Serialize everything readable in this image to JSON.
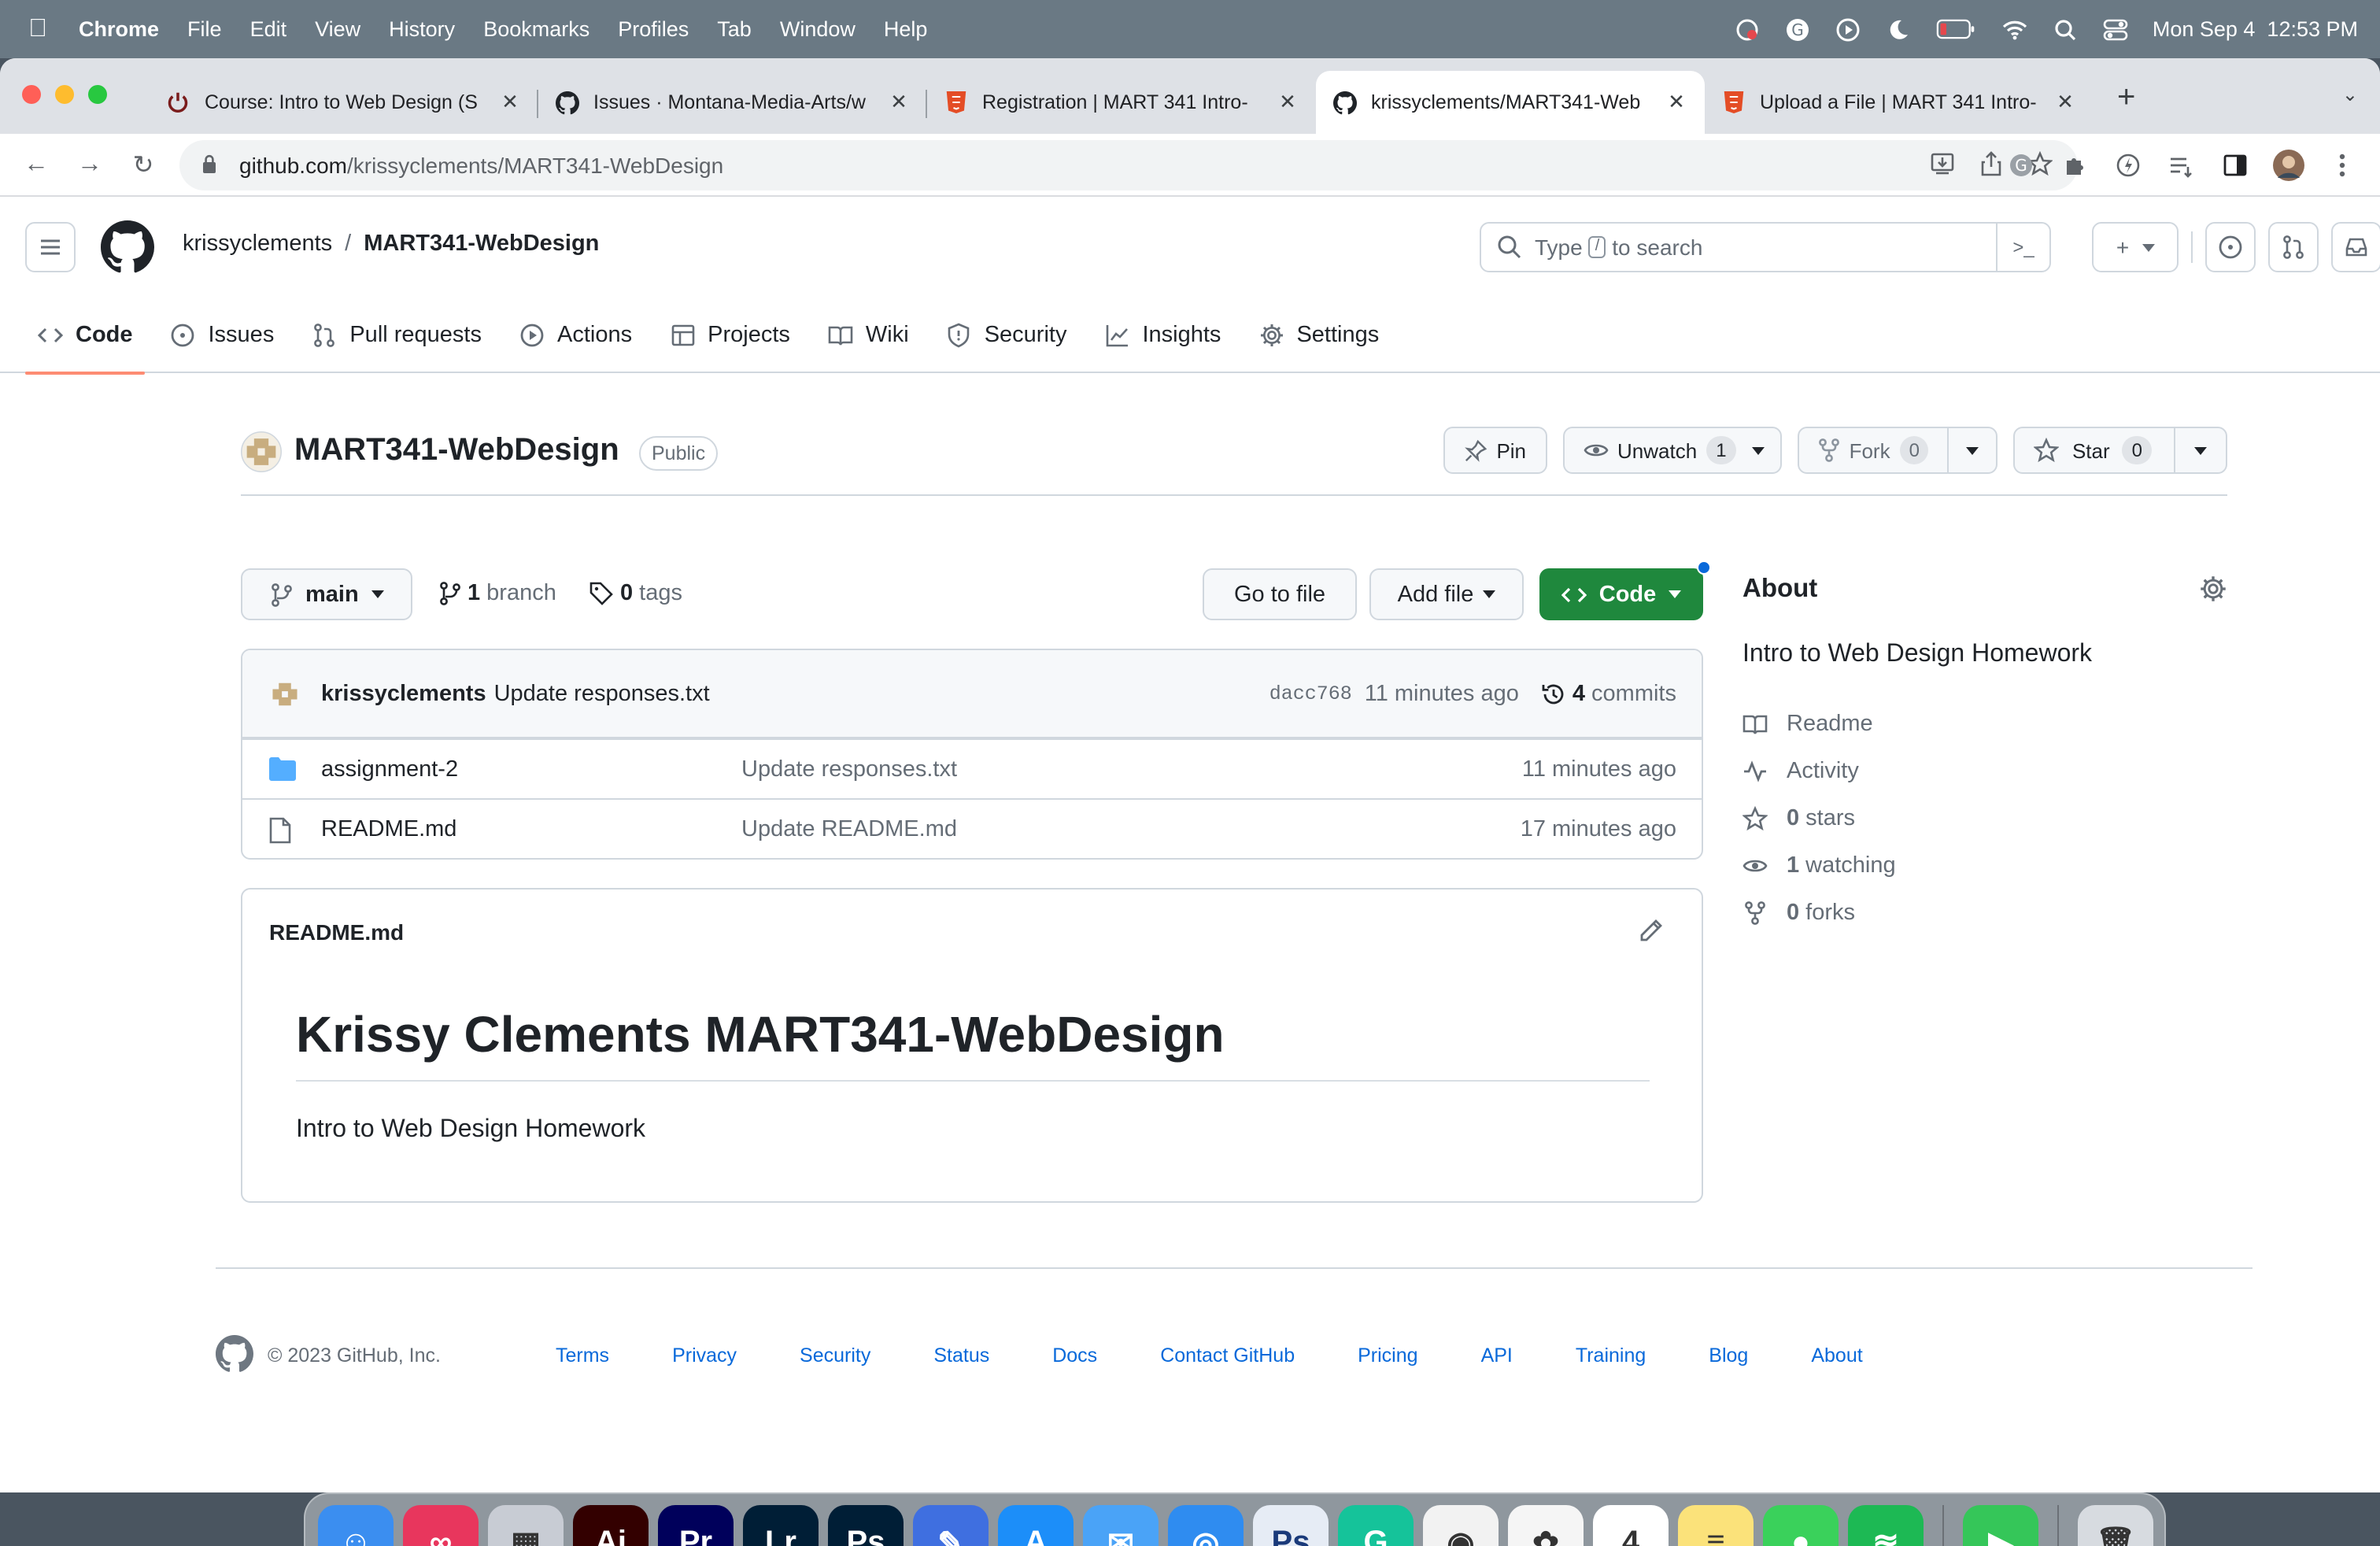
{
  "menubar": {
    "app": "Chrome",
    "items": [
      "File",
      "Edit",
      "View",
      "History",
      "Bookmarks",
      "Profiles",
      "Tab",
      "Window",
      "Help"
    ],
    "datetime": "Mon Sep 4  12:53 PM"
  },
  "browser": {
    "tabs": [
      {
        "title": "Course: Intro to Web Design (S",
        "favicon": "power-icon",
        "active": false
      },
      {
        "title": "Issues · Montana-Media-Arts/w",
        "favicon": "github-icon",
        "active": false
      },
      {
        "title": "Registration | MART 341 Intro-",
        "favicon": "html5-icon",
        "active": false
      },
      {
        "title": "krissyclements/MART341-Web",
        "favicon": "github-icon",
        "active": true
      },
      {
        "title": "Upload a File | MART 341 Intro-",
        "favicon": "html5-icon",
        "active": false
      }
    ],
    "url_host": "github.com",
    "url_path": "/krissyclements/MART341-WebDesign"
  },
  "github": {
    "owner": "krissyclements",
    "repo": "MART341-WebDesign",
    "search_prefix": "Type",
    "search_key": "/",
    "search_suffix": "to search",
    "nav": [
      {
        "label": "Code",
        "icon": "code-icon",
        "selected": true
      },
      {
        "label": "Issues",
        "icon": "issue-icon"
      },
      {
        "label": "Pull requests",
        "icon": "pull-request-icon"
      },
      {
        "label": "Actions",
        "icon": "play-icon"
      },
      {
        "label": "Projects",
        "icon": "table-icon"
      },
      {
        "label": "Wiki",
        "icon": "book-icon"
      },
      {
        "label": "Security",
        "icon": "shield-icon"
      },
      {
        "label": "Insights",
        "icon": "graph-icon"
      },
      {
        "label": "Settings",
        "icon": "gear-icon"
      }
    ],
    "visibility": "Public",
    "pin_label": "Pin",
    "watch_label": "Unwatch",
    "watch_count": "1",
    "fork_label": "Fork",
    "fork_count": "0",
    "star_label": "Star",
    "star_count": "0",
    "branch": "main",
    "branch_count": "1",
    "branch_label": "branch",
    "tag_count": "0",
    "tag_label": "tags",
    "goto_file": "Go to file",
    "add_file": "Add file",
    "code_button": "Code",
    "latest_commit": {
      "author": "krissyclements",
      "message": "Update responses.txt",
      "sha": "dacc768",
      "age": "11 minutes ago",
      "commit_count": "4",
      "commit_label": "commits"
    },
    "files": [
      {
        "name": "assignment-2",
        "type": "folder",
        "message": "Update responses.txt",
        "age": "11 minutes ago"
      },
      {
        "name": "README.md",
        "type": "file",
        "message": "Update README.md",
        "age": "17 minutes ago"
      }
    ],
    "readme": {
      "filename": "README.md",
      "heading": "Krissy Clements MART341-WebDesign",
      "body": "Intro to Web Design Homework"
    },
    "about": {
      "title": "About",
      "description": "Intro to Web Design Homework",
      "readme": "Readme",
      "activity": "Activity",
      "stars_count": "0",
      "stars_label": "stars",
      "watching_count": "1",
      "watching_label": "watching",
      "forks_count": "0",
      "forks_label": "forks"
    },
    "footer": {
      "copyright": "© 2023 GitHub, Inc.",
      "links": [
        "Terms",
        "Privacy",
        "Security",
        "Status",
        "Docs",
        "Contact GitHub",
        "Pricing",
        "API",
        "Training",
        "Blog",
        "About"
      ]
    }
  },
  "dock": [
    {
      "name": "Finder",
      "icon": "finder-icon",
      "color": "#3b8ef0",
      "glyph": "☺",
      "running": true
    },
    {
      "name": "Creative Cloud",
      "icon": "creative-cloud-icon",
      "color": "#e8365d",
      "glyph": "∞",
      "running": false
    },
    {
      "name": "Launchpad",
      "icon": "launchpad-icon",
      "color": "#c8ccd4",
      "glyph": "▦",
      "running": false
    },
    {
      "name": "Illustrator",
      "icon": "illustrator-icon",
      "color": "#330000",
      "glyph": "Ai",
      "running": false
    },
    {
      "name": "Premiere Pro",
      "icon": "premiere-icon",
      "color": "#00005b",
      "glyph": "Pr",
      "running": false
    },
    {
      "name": "Lightroom",
      "icon": "lightroom-icon",
      "color": "#001e36",
      "glyph": "Lr",
      "running": false
    },
    {
      "name": "Photoshop",
      "icon": "photoshop-icon",
      "color": "#001e36",
      "glyph": "Ps",
      "running": true
    },
    {
      "name": "Pencil",
      "icon": "pencil-app-icon",
      "color": "#3f6fe0",
      "glyph": "✎",
      "running": true
    },
    {
      "name": "App Store",
      "icon": "app-store-icon",
      "color": "#1c8ef9",
      "glyph": "A",
      "running": true
    },
    {
      "name": "Mail",
      "icon": "mail-icon",
      "color": "#4aa3f7",
      "glyph": "✉",
      "running": true
    },
    {
      "name": "Safari",
      "icon": "safari-icon",
      "color": "#2f8cf0",
      "glyph": "◎",
      "running": false
    },
    {
      "name": "Photoshop Express",
      "icon": "photoshop-express-icon",
      "color": "#e6ecf5",
      "glyph": "Ps",
      "running": false
    },
    {
      "name": "Grammarly",
      "icon": "grammarly-icon",
      "color": "#15c39a",
      "glyph": "G",
      "running": false
    },
    {
      "name": "Chrome",
      "icon": "chrome-icon",
      "color": "#f2f2f2",
      "glyph": "◉",
      "running": true
    },
    {
      "name": "Photos",
      "icon": "photos-icon",
      "color": "#f5f5f5",
      "glyph": "✿",
      "running": false
    },
    {
      "name": "Calendar",
      "icon": "calendar-icon",
      "color": "#ffffff",
      "glyph": "4",
      "running": false
    },
    {
      "name": "Notes",
      "icon": "notes-icon",
      "color": "#fbe27a",
      "glyph": "≡",
      "running": true
    },
    {
      "name": "Messages",
      "icon": "messages-icon",
      "color": "#3ad15b",
      "glyph": "●",
      "running": true
    },
    {
      "name": "Spotify",
      "icon": "spotify-icon",
      "color": "#1db954",
      "glyph": "≋",
      "running": true
    },
    {
      "name": "FaceTime",
      "icon": "facetime-icon",
      "color": "#35c659",
      "glyph": "▶",
      "running": false
    },
    {
      "name": "Trash",
      "icon": "trash-icon",
      "color": "#d7dbe0",
      "glyph": "🗑",
      "running": false
    }
  ],
  "colors": {
    "accent_green": "#1f883d",
    "link_blue": "#0969da",
    "tab_underline": "#fd8c73"
  }
}
